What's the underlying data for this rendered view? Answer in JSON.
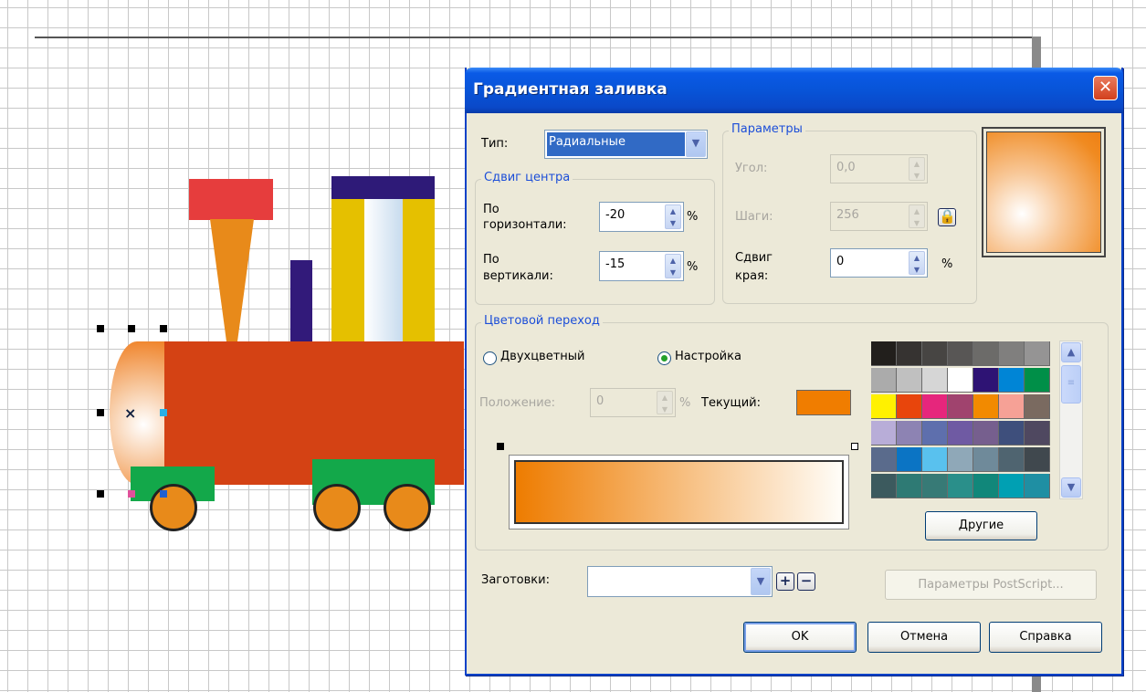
{
  "dialog": {
    "title": "Градиентная заливка",
    "close_glyph": "✕",
    "type_label": "Тип:",
    "type_value": "Радиальные",
    "center_offset": {
      "title": "Сдвиг центра",
      "horizontal_label_1": "По",
      "horizontal_label_2": "горизонтали:",
      "horizontal_value": "-20",
      "vertical_label_1": "По",
      "vertical_label_2": "вертикали:",
      "vertical_value": "-15",
      "percent": "%"
    },
    "params": {
      "title": "Параметры",
      "angle_label": "Угол:",
      "angle_value": "0,0",
      "steps_label": "Шаги:",
      "steps_value": "256",
      "edge_label_1": "Сдвиг",
      "edge_label_2": "края:",
      "edge_value": "0",
      "percent": "%"
    },
    "color_transition": {
      "title": "Цветовой переход",
      "two_color_label": "Двухцветный",
      "custom_label": "Настройка",
      "selected_mode": "custom",
      "position_label": "Положение:",
      "position_value": "0",
      "position_percent": "%",
      "current_label": "Текущий:",
      "current_color": "#f07d00",
      "gradient_start": "#ee7c00",
      "gradient_end": "#fffdf8",
      "other_button": "Другие"
    },
    "palette": [
      [
        "#221f1c",
        "#363331",
        "#474543",
        "#585655",
        "#6c6b69",
        "#807f7e",
        "#959494"
      ],
      [
        "#ababab",
        "#c0c0c0",
        "#d6d6d6",
        "#ffffff",
        "#2e1374",
        "#0085d6",
        "#008f48"
      ],
      [
        "#fff100",
        "#e8450c",
        "#e6267c",
        "#a0436e",
        "#f28a00",
        "#f6a196",
        "#7a6a60"
      ],
      [
        "#b8add8",
        "#8d83b3",
        "#5e6fad",
        "#6f5aa3",
        "#765f8e",
        "#3e4f7c",
        "#4f4860"
      ],
      [
        "#5a6b8c",
        "#0b74c4",
        "#59c1ee",
        "#8fa8b8",
        "#6f8a9a",
        "#4f6470",
        "#40484e"
      ],
      [
        "#3c5a5e",
        "#2e7a74",
        "#377a76",
        "#2a8f8a",
        "#11877a",
        "#00a0b3",
        "#1f8fa3"
      ]
    ],
    "presets_label": "Заготовки:",
    "presets_value": "",
    "postscript_button": "Параметры PostScript...",
    "ok_button": "OK",
    "cancel_button": "Отмена",
    "help_button": "Справка"
  }
}
